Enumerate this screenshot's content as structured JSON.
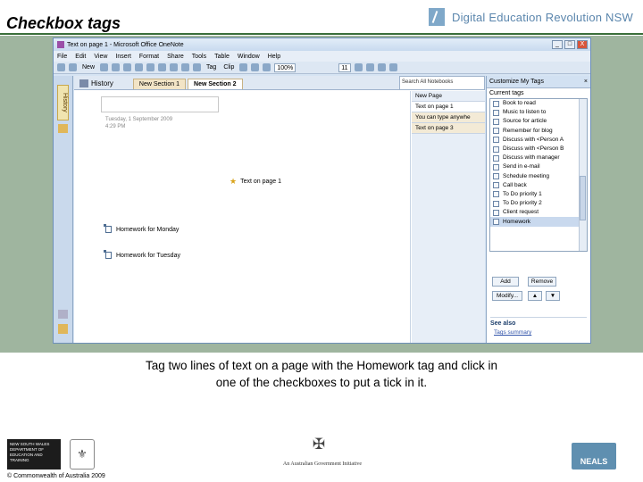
{
  "slide": {
    "title": "Checkbox tags",
    "logo_text": "Digital Education Revolution NSW",
    "caption_line1": "Tag two lines of text on a page with the Homework tag and click in",
    "caption_line2": "one of the checkboxes to put a tick in it."
  },
  "window": {
    "title": "Text on page 1 - Microsoft Office OneNote",
    "controls": [
      "_",
      "□",
      "X"
    ]
  },
  "menu": [
    "File",
    "Edit",
    "View",
    "Insert",
    "Format",
    "Share",
    "Tools",
    "Table",
    "Window",
    "Help"
  ],
  "toolbar": {
    "new_label": "New",
    "tag_label": "Tag",
    "clip_label": "Clip",
    "zoom_value": "100%",
    "font_size_value": "11"
  },
  "navbar": {
    "history_label": "History"
  },
  "section_tabs": {
    "history_label": "History",
    "tabs": [
      "New Section 1",
      "New Section 2"
    ],
    "search_placeholder": "Search All Notebooks"
  },
  "page": {
    "date": "Tuesday, 1 September 2009",
    "time": "4:29 PM",
    "note_text": "Text on page 1",
    "homework_items": [
      "Homework for Monday",
      "Homework for Tuesday"
    ]
  },
  "page_list": {
    "new_page": "New Page",
    "pages": [
      "Text on page 1",
      "You can type anywhe",
      "Text on page 3"
    ]
  },
  "task_pane": {
    "title": "Customize My Tags",
    "current_tags_label": "Current tags",
    "tags": [
      "Book to read",
      "Music to listen to",
      "Source for article",
      "Remember for blog",
      "Discuss with <Person A",
      "Discuss with <Person B",
      "Discuss with manager",
      "Send in e-mail",
      "Schedule meeting",
      "Call back",
      "To Do priority 1",
      "To Do priority 2",
      "Client request",
      "Homework"
    ],
    "add_label": "Add",
    "remove_label": "Remove",
    "modify_label": "Modify...",
    "see_also_label": "See also",
    "see_also_link": "Tags summary"
  },
  "footer": {
    "dept_logo_text": "NEW SOUTH WALES DEPARTMENT OF EDUCATION AND TRAINING",
    "copyright": "© Commonwealth of Australia 2009",
    "aus_gov_text": "An Australian Government Initiative",
    "neals_label": "NEALS"
  }
}
